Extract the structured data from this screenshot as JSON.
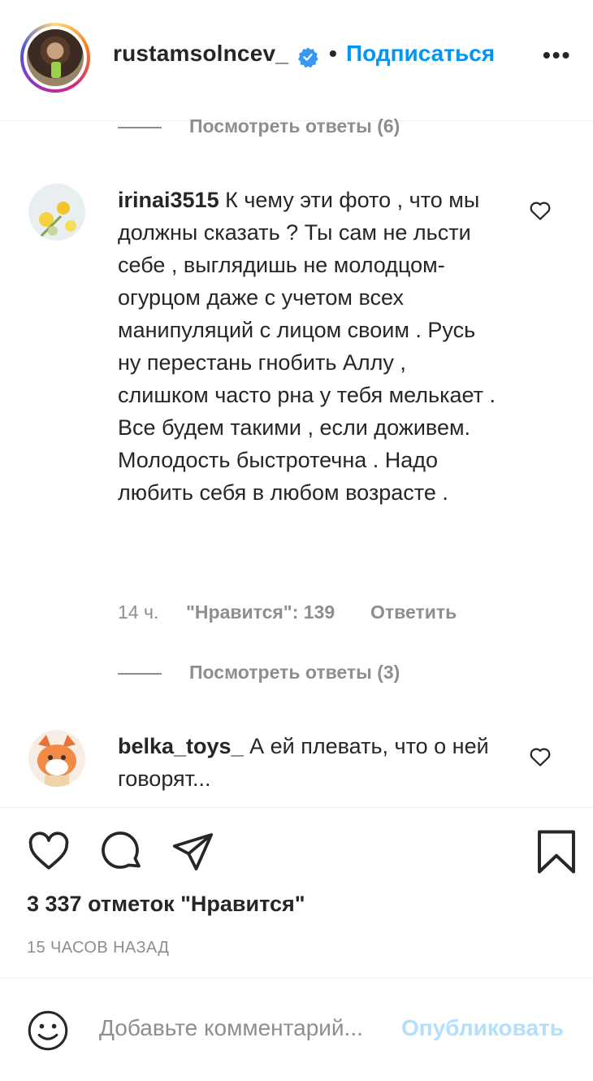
{
  "header": {
    "username": "rustamsolncev_",
    "separator": "•",
    "follow_label": "Подписаться",
    "more_label": "•••"
  },
  "comments": [
    {
      "replies_label": "Посмотреть ответы (6)"
    },
    {
      "username": "irinai3515",
      "text": "К чему эти фото , что мы должны сказать ? Ты сам не льсти себе , выглядишь не молодцом-огурцом даже с учетом всех манипуляций с лицом своим . Русь ну перестань гнобить Аллу , слишком часто рна у тебя мелькает . Все будем такими , если доживем. Молодость быстротечна . Надо любить себя в любом возрасте .",
      "time": "14 ч.",
      "likes": "\"Нравится\": 139",
      "reply_label": "Ответить",
      "replies_label": "Посмотреть ответы (3)"
    },
    {
      "username": "belka_toys_",
      "text": "А ей плевать, что о ней говорят..."
    }
  ],
  "actions": {
    "likes_count": "3 337 отметок \"Нравится\"",
    "posted_time": "15 ЧАСОВ НАЗАД"
  },
  "comment_box": {
    "placeholder": "Добавьте комментарий...",
    "publish_label": "Опубликовать"
  },
  "colors": {
    "accent": "#0095f6",
    "muted": "#8e8e8e",
    "text": "#262626",
    "publish_disabled": "#b2dffc"
  },
  "icons": [
    "verified-icon",
    "more-icon",
    "heart-icon",
    "comment-icon",
    "share-icon",
    "bookmark-icon",
    "emoji-icon"
  ]
}
